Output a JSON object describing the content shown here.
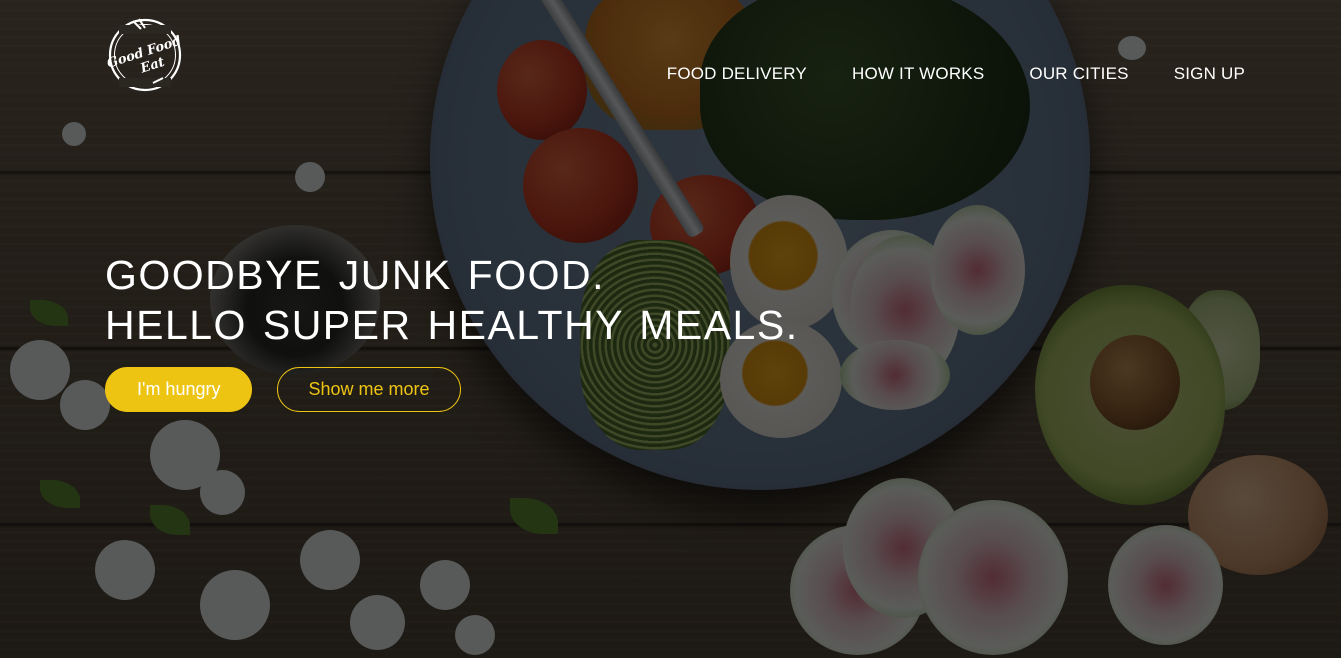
{
  "logo": {
    "line1": "Good Food",
    "line2": "Eat"
  },
  "nav": {
    "items": [
      {
        "label": "FOOD DELIVERY"
      },
      {
        "label": "HOW IT WORKS"
      },
      {
        "label": "OUR CITIES"
      },
      {
        "label": "SIGN UP"
      }
    ]
  },
  "hero": {
    "heading_line1": "GOODBYE JUNK FOOD.",
    "heading_line2": "HELLO SUPER HEALTHY MEALS.",
    "primary_button": "I'm hungry",
    "secondary_button": "Show me more"
  },
  "colors": {
    "accent": "#eec413",
    "text": "#ffffff"
  }
}
